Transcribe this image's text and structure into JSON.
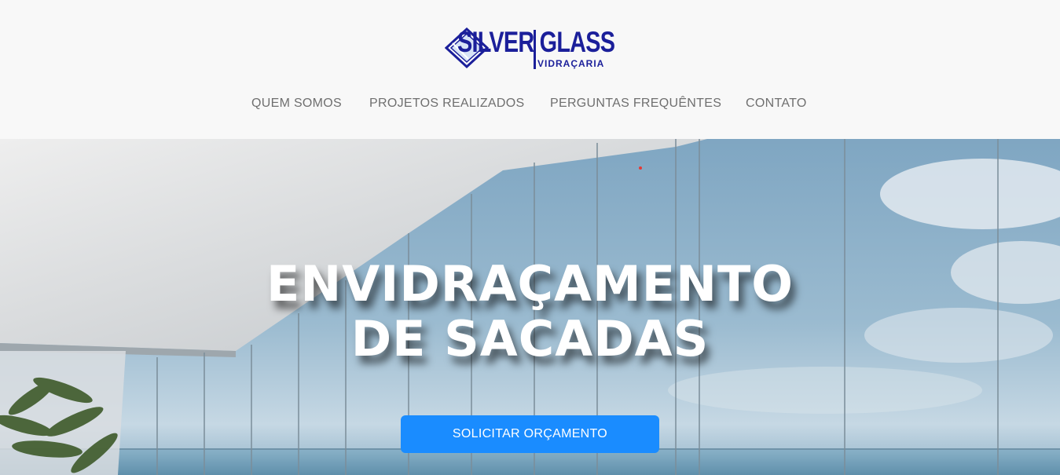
{
  "logo": {
    "brand_main": "SILVER GLASS",
    "brand_sub": "VIDRAÇARIA",
    "icon": "diamond-glass-icon",
    "color": "#1b1f9a"
  },
  "nav": {
    "items": [
      {
        "label": "QUEM SOMOS"
      },
      {
        "label": "PROJETOS REALIZADOS"
      },
      {
        "label": "PERGUNTAS FREQUÊNTES"
      },
      {
        "label": "CONTATO"
      }
    ]
  },
  "hero": {
    "title_line1": "ENVIDRAÇAMENTO",
    "title_line2": "DE SACADAS",
    "cta_label": "SOLICITAR ORÇAMENTO",
    "cta_color": "#1a8cff",
    "background": "balcony-glass-photo"
  }
}
